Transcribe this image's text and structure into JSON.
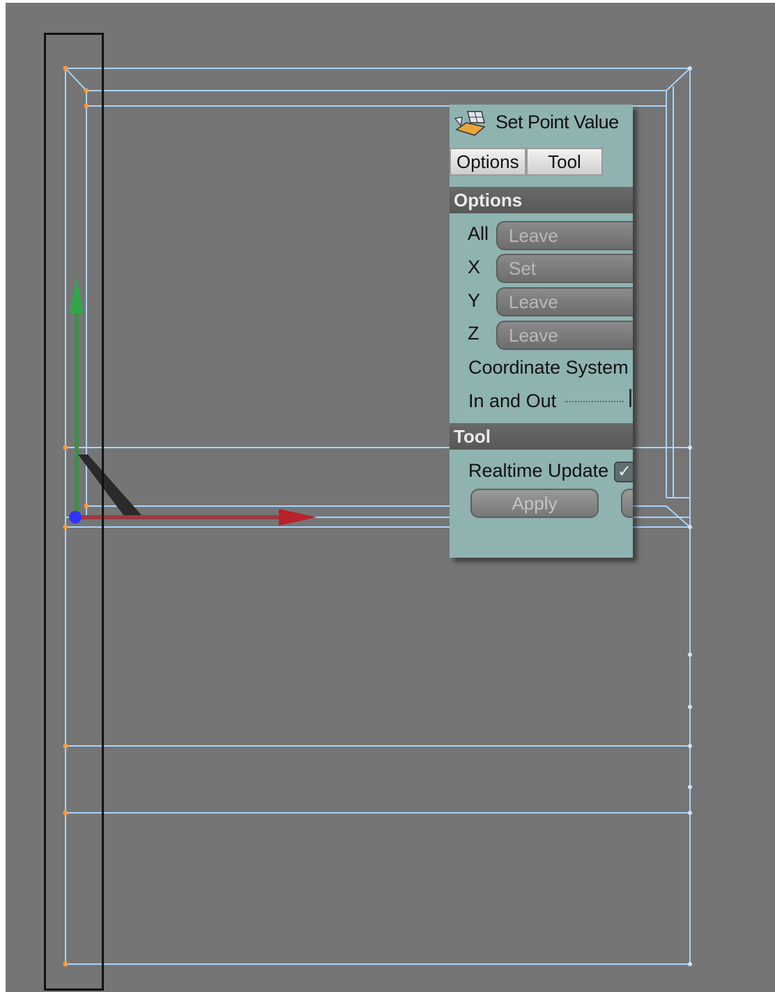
{
  "panel": {
    "title": "Set Point Value",
    "title_icon": "set-point-value-icon",
    "tabs": [
      "Options",
      "Tool"
    ],
    "options_section": {
      "header": "Options",
      "rows": [
        {
          "label": "All",
          "value": "Leave"
        },
        {
          "label": "X",
          "value": "Set"
        },
        {
          "label": "Y",
          "value": "Leave"
        },
        {
          "label": "Z",
          "value": "Leave"
        }
      ],
      "coordinate_system_label": "Coordinate System",
      "in_and_out_label": "In and Out"
    },
    "tool_section": {
      "header": "Tool",
      "realtime_update_label": "Realtime Update",
      "realtime_update_checked": true,
      "realtime_update_mark": "✓",
      "apply_label": "Apply"
    }
  },
  "viewport": {
    "background": "#757575",
    "wire_color": "#a9d4ff",
    "point_color": "#ff9a3a",
    "axis_colors": {
      "y": "#2fa84a",
      "x": "#b8222a",
      "z": "#3333ff"
    }
  }
}
